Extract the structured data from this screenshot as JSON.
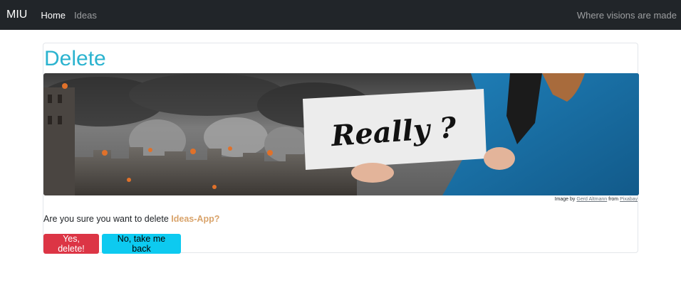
{
  "navbar": {
    "brand": "MIU",
    "links": [
      {
        "label": "Home"
      },
      {
        "label": "Ideas"
      }
    ],
    "tagline": "Where visions are made"
  },
  "page": {
    "title": "Delete",
    "sign_text": "Really ?",
    "credit": {
      "prefix": "Image by",
      "author": "Gerd Altmann",
      "middle": "from",
      "source": "Pixabay"
    },
    "question": "Are you sure you want to delete",
    "item_name": "Ideas-App?",
    "confirm_button": "Yes, delete!",
    "cancel_button": "No, take me back"
  },
  "colors": {
    "navbar_bg": "#212529",
    "title": "#2bb3cf",
    "item_name": "#d9a36a",
    "danger": "#dc3545",
    "info": "#0dcaf0"
  }
}
